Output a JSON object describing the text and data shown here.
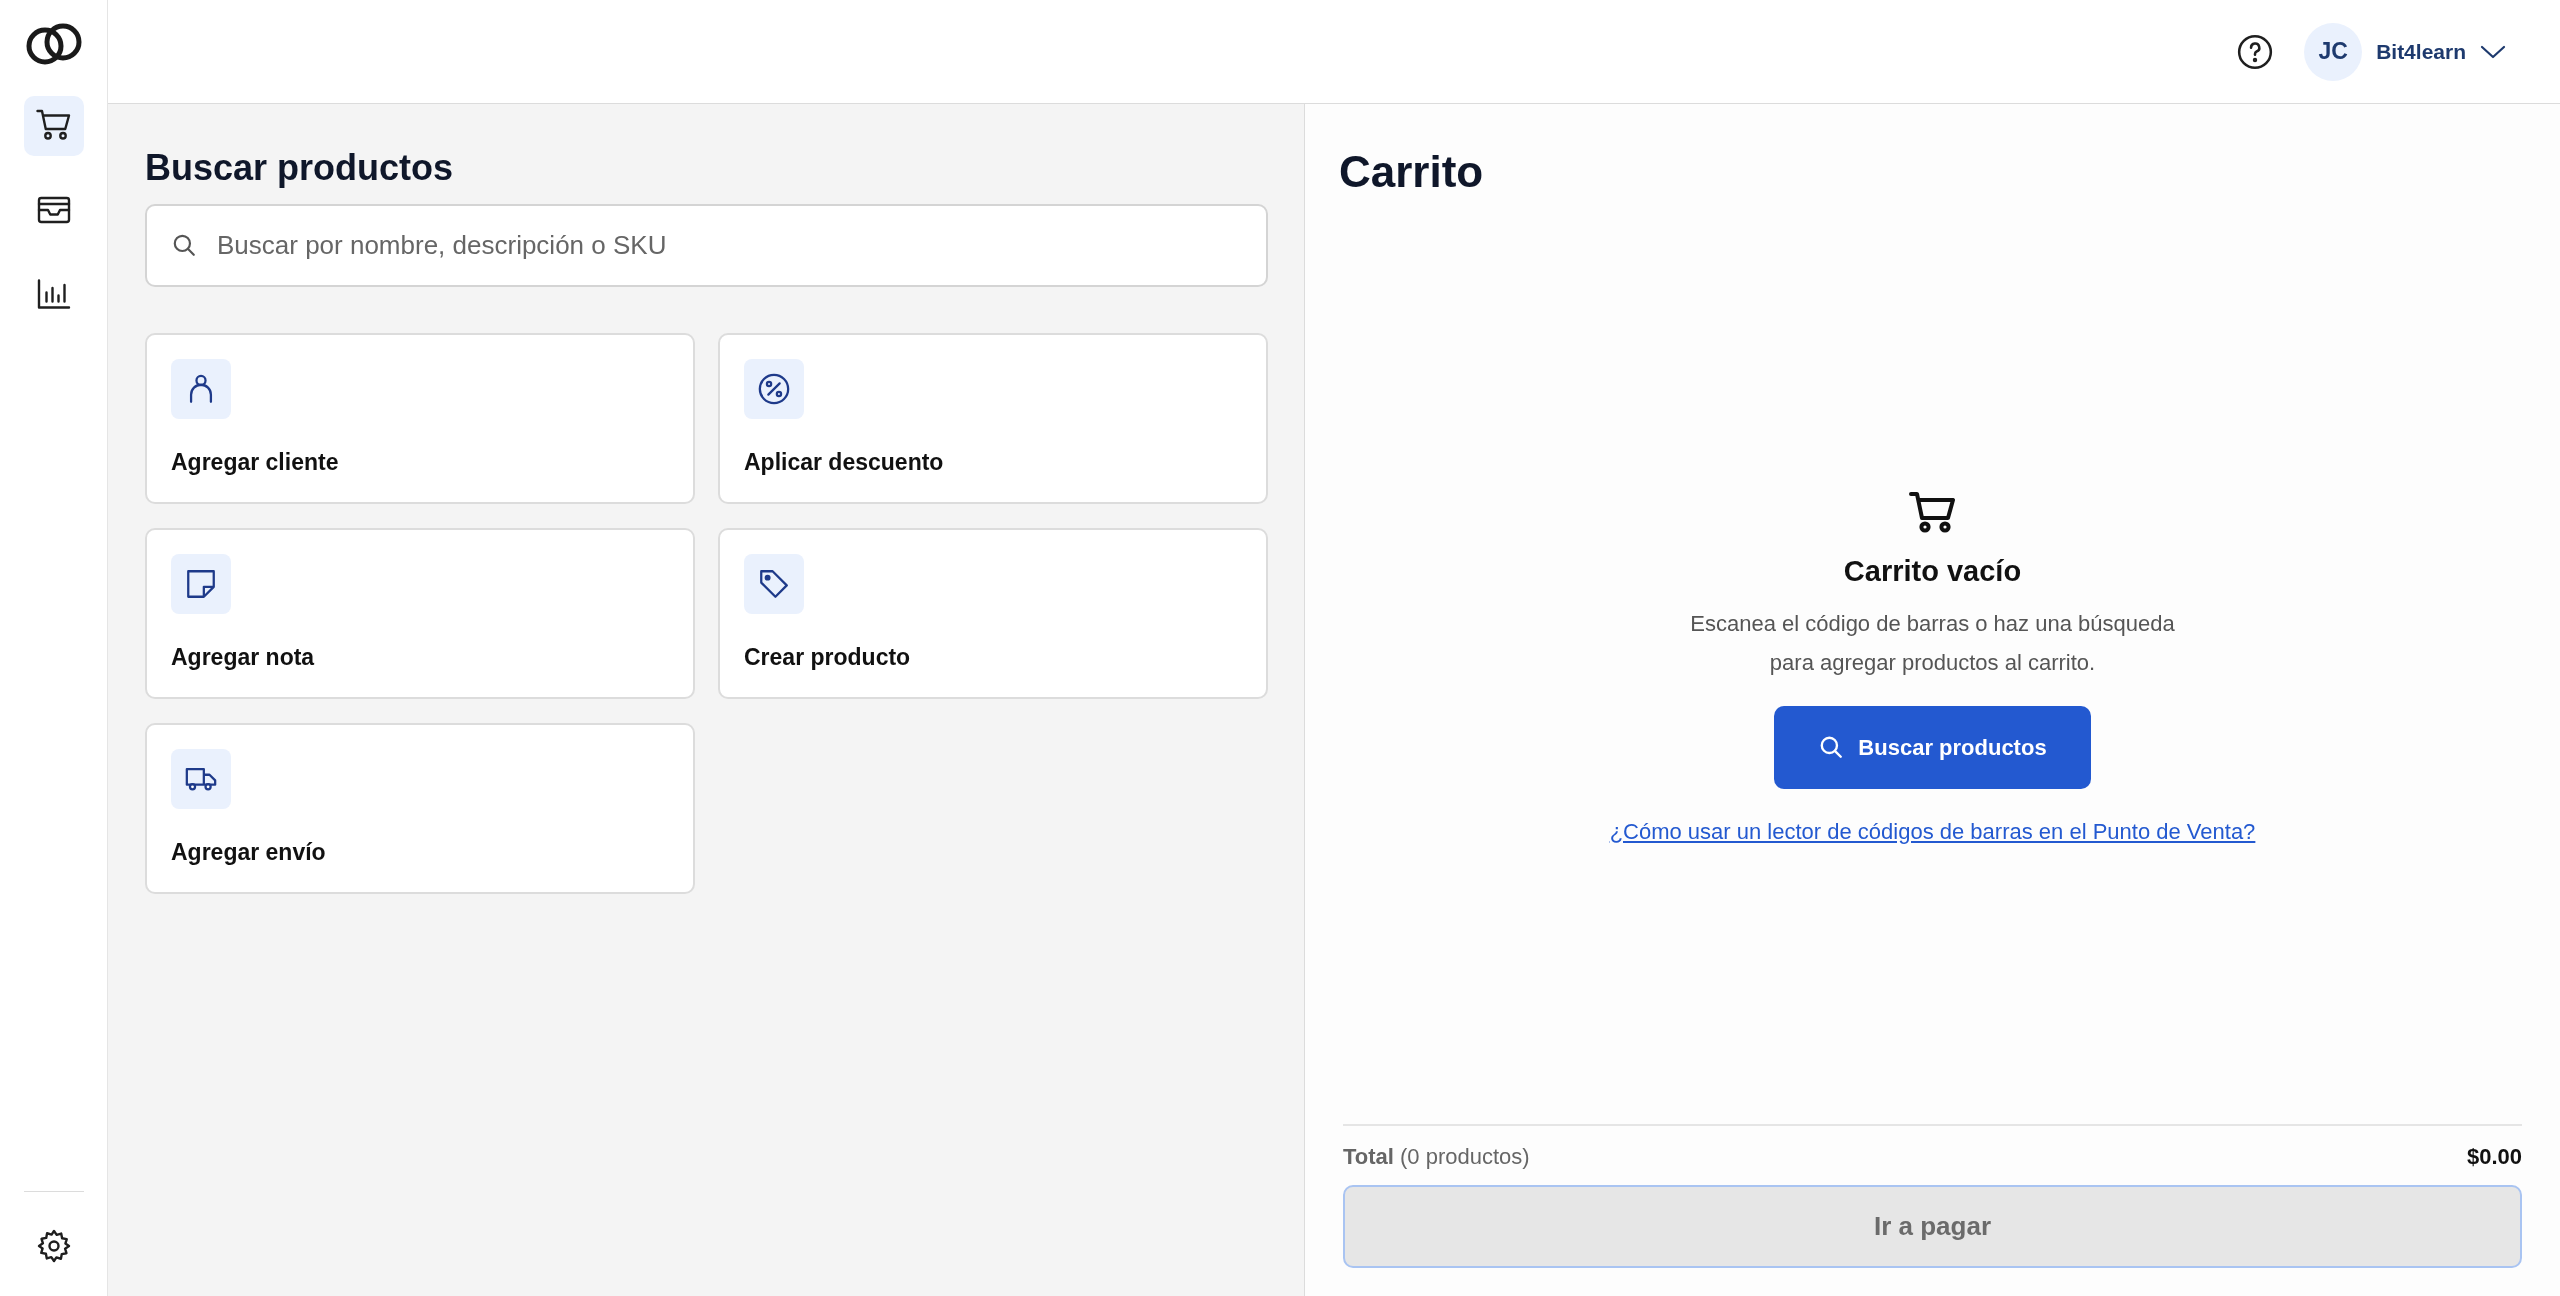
{
  "sidebar": {
    "items": [
      {
        "kind": "cart",
        "selected": true
      },
      {
        "kind": "inbox",
        "selected": false
      },
      {
        "kind": "chart",
        "selected": false
      }
    ],
    "bottom_items": [
      {
        "kind": "settings"
      }
    ]
  },
  "header": {
    "avatar_initials": "JC",
    "account_name": "Bit4learn"
  },
  "search_panel": {
    "title": "Buscar productos",
    "search": {
      "placeholder": "Buscar por nombre, descripción o SKU"
    },
    "actions": [
      {
        "kind": "person",
        "label": "Agregar cliente"
      },
      {
        "kind": "percent",
        "label": "Aplicar descuento"
      },
      {
        "kind": "note",
        "label": "Agregar nota"
      },
      {
        "kind": "tag",
        "label": "Crear producto"
      },
      {
        "kind": "truck",
        "label": "Agregar envío"
      }
    ]
  },
  "cart": {
    "title": "Carrito",
    "empty_title": "Carrito vacío",
    "empty_lines": [
      "Escanea el código de barras o haz una búsqueda",
      "para agregar productos al carrito."
    ],
    "search_button": "Buscar productos",
    "help_link": "¿Cómo usar un lector de códigos de barras en el Punto de Venta?",
    "total_label": "**Total** (0 productos)",
    "total_value": "$0.00",
    "checkout": {
      "label": "Ir a pagar",
      "disabled": true
    }
  }
}
